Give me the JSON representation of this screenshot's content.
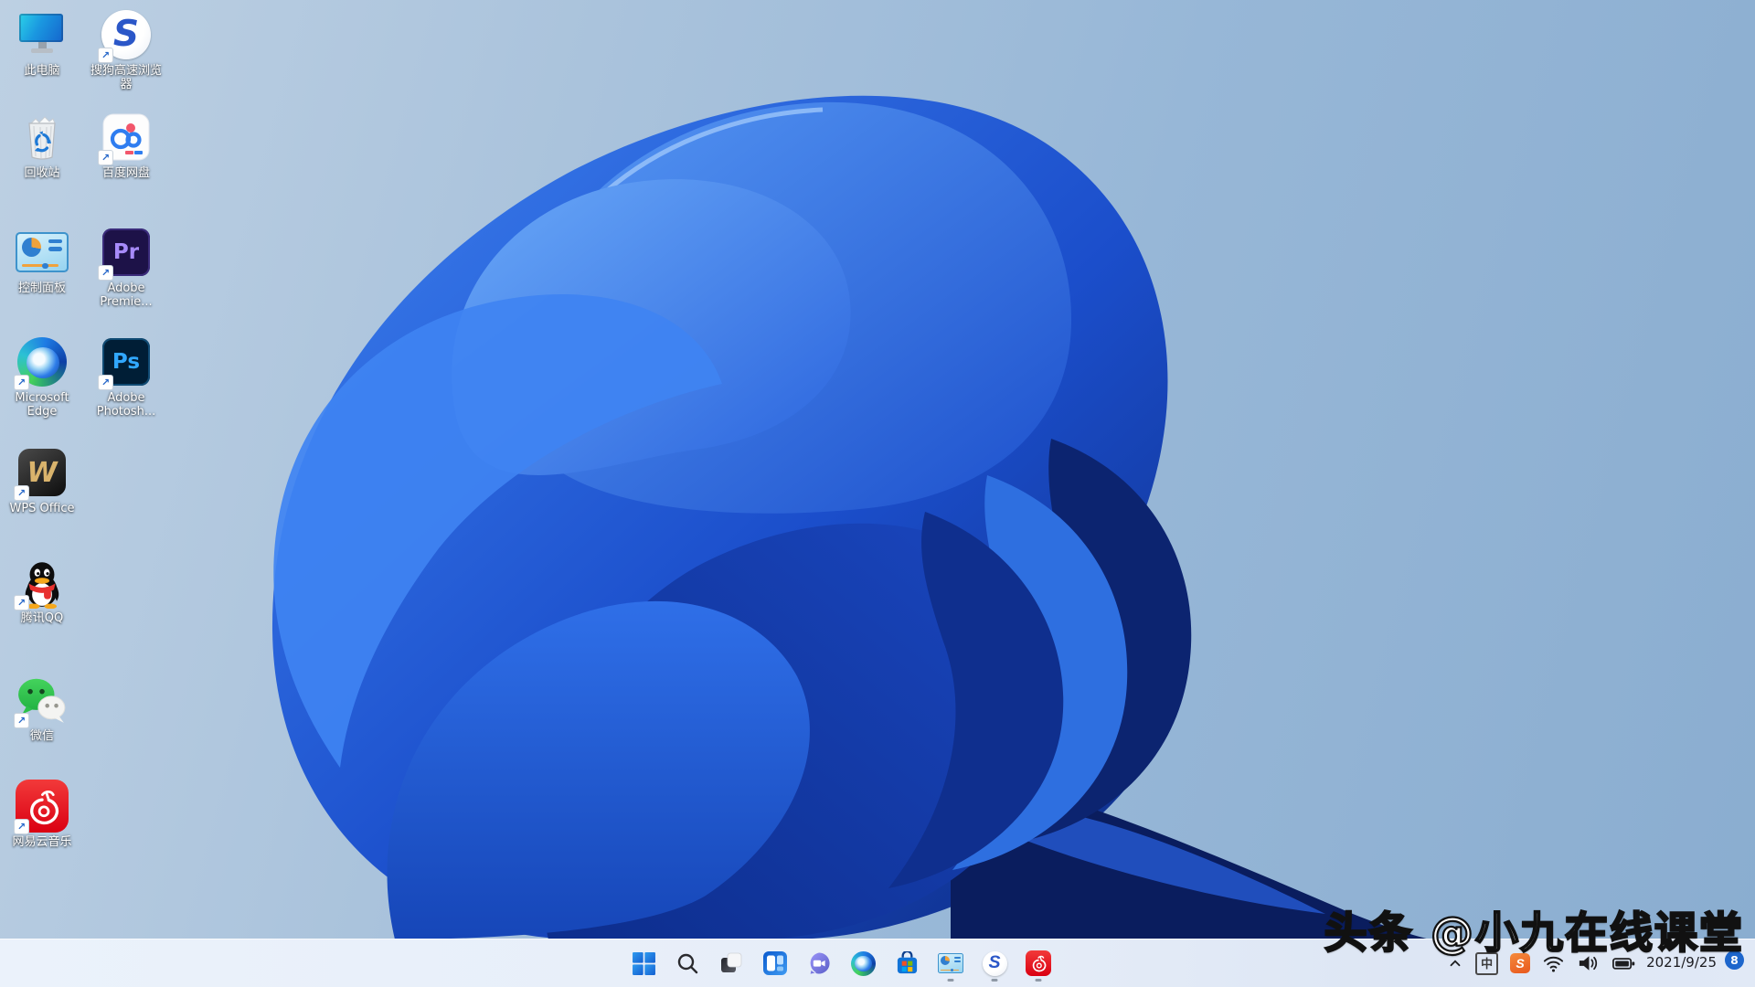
{
  "colors": {
    "background_left": "#aac3dc",
    "background_right": "#8aadd0",
    "taskbar_bg": "#e6edf8",
    "bloom_bright": "#2f6fe8",
    "bloom_dark": "#0c2a80",
    "badge_blue": "#1d66cc",
    "netease_red": "#e60019",
    "wechat_green": "#3ed157",
    "sogou_orange": "#e8591e"
  },
  "desktop_icons": [
    {
      "id": "this-pc",
      "label": "此电脑",
      "shortcut": false
    },
    {
      "id": "sogou-browser",
      "label": "搜狗高速浏览器",
      "shortcut": true
    },
    {
      "id": "recycle-bin",
      "label": "回收站",
      "shortcut": false
    },
    {
      "id": "baidu-netdisk",
      "label": "百度网盘",
      "shortcut": true
    },
    {
      "id": "control-panel",
      "label": "控制面板",
      "shortcut": false
    },
    {
      "id": "adobe-premiere",
      "label": "Adobe Premie...",
      "shortcut": true,
      "logo_text": "Pr"
    },
    {
      "id": "microsoft-edge",
      "label": "Microsoft Edge",
      "shortcut": true
    },
    {
      "id": "adobe-photoshop",
      "label": "Adobe Photosh...",
      "shortcut": true,
      "logo_text": "Ps"
    },
    {
      "id": "wps-office",
      "label": "WPS Office",
      "shortcut": true,
      "logo_text": "W"
    },
    {
      "id": "tencent-qq",
      "label": "腾讯QQ",
      "shortcut": true
    },
    {
      "id": "wechat",
      "label": "微信",
      "shortcut": true
    },
    {
      "id": "netease-music",
      "label": "网易云音乐",
      "shortcut": true
    }
  ],
  "taskbar": {
    "buttons": [
      "start",
      "search",
      "task-view",
      "widgets",
      "chat",
      "edge",
      "store",
      "control-panel",
      "sogou-browser",
      "netease-music"
    ],
    "running": [
      "control-panel",
      "sogou-browser",
      "netease-music"
    ],
    "tray": {
      "ime_label": "中",
      "sogou_ime": "S",
      "date": "2021/9/25",
      "badge": "8"
    }
  },
  "logos": {
    "sogou_letter": "S"
  },
  "watermark": {
    "text": "头条 @小九在线课堂"
  }
}
